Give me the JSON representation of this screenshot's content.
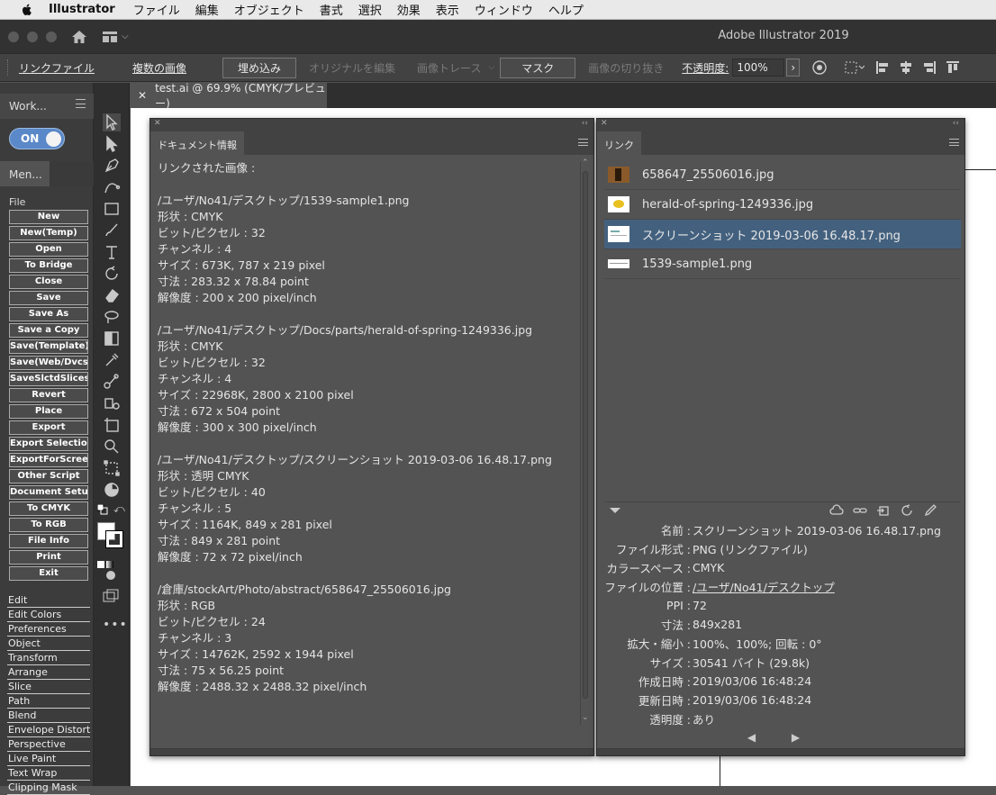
{
  "menubar": {
    "app": "Illustrator",
    "items": [
      "ファイル",
      "編集",
      "オブジェクト",
      "書式",
      "選択",
      "効果",
      "表示",
      "ウィンドウ",
      "ヘルプ"
    ]
  },
  "window": {
    "title": "Adobe Illustrator 2019"
  },
  "control_bar": {
    "link_file": "リンクファイル",
    "multiple_images": "複数の画像",
    "embed": "埋め込み",
    "edit_original": "オリジナルを編集",
    "image_trace": "画像トレース",
    "mask": "マスク",
    "crop_image": "画像の切り抜き",
    "opacity_label": "不透明度:",
    "opacity_value": "100%"
  },
  "document_tab": {
    "label": "test.ai @ 69.9% (CMYK/プレビュー)"
  },
  "workspace": {
    "label": "Work...",
    "toggle": "ON"
  },
  "menu_panel": {
    "tab": "Men...",
    "file_header": "File",
    "file_buttons": [
      "New",
      "New(Temp)",
      "Open",
      "To Bridge",
      "Close",
      "Save",
      "Save As",
      "Save a Copy",
      "Save(Template)",
      "Save(Web/Dvcs)",
      "SaveSlctdSlices",
      "Revert",
      "Place",
      "Export",
      "Export Selection",
      "ExportForScreens",
      "Other Script",
      "Document Setup",
      "To CMYK",
      "To RGB",
      "File Info",
      "Print",
      "Exit"
    ],
    "sections": [
      "Edit",
      "Edit Colors",
      "Preferences",
      "Object",
      "Transform",
      "Arrange",
      "Slice",
      "Path",
      "Blend",
      "Envelope Distort",
      "Perspective",
      "Live Paint",
      "Text Wrap",
      "Clipping Mask"
    ]
  },
  "tools": [
    "selection-tool",
    "direct-selection-tool",
    "pen-tool",
    "curvature-tool",
    "rectangle-tool",
    "paintbrush-tool",
    "type-tool",
    "rotate-tool",
    "eraser-tool",
    "lasso-tool",
    "gradient-tool",
    "eyedropper-tool",
    "blend-tool",
    "symbol-sprayer-tool",
    "artboard-tool",
    "zoom-tool",
    "free-transform-tool",
    "pie-graph-tool"
  ],
  "doc_info": {
    "tab": "ドキュメント情報",
    "text": "リンクされた画像 :\n\n/ユーザ/No41/デスクトップ/1539-sample1.png\n形状 : CMYK\nビット/ピクセル : 32\nチャンネル : 4\nサイズ : 673K, 787 x 219 pixel\n寸法 : 283.32 x 78.84 point\n解像度 : 200 x 200 pixel/inch\n\n/ユーザ/No41/デスクトップ/Docs/parts/herald-of-spring-1249336.jpg\n形状 : CMYK\nビット/ピクセル : 32\nチャンネル : 4\nサイズ : 22968K, 2800 x 2100 pixel\n寸法 : 672 x 504 point\n解像度 : 300 x 300 pixel/inch\n\n/ユーザ/No41/デスクトップ/スクリーンショット 2019-03-06 16.48.17.png\n形状 : 透明 CMYK\nビット/ピクセル : 40\nチャンネル : 5\nサイズ : 1164K, 849 x 281 pixel\n寸法 : 849 x 281 point\n解像度 : 72 x 72 pixel/inch\n\n/倉庫/stockArt/Photo/abstract/658647_25506016.jpg\n形状 : RGB\nビット/ピクセル : 24\nチャンネル : 3\nサイズ : 14762K, 2592 x 1944 pixel\n寸法 : 75 x 56.25 point\n解像度 : 2488.32 x 2488.32 pixel/inch"
  },
  "links": {
    "tab": "リンク",
    "items": [
      {
        "name": "658647_25506016.jpg",
        "selected": false
      },
      {
        "name": "herald-of-spring-1249336.jpg",
        "selected": false
      },
      {
        "name": "スクリーンショット 2019-03-06 16.48.17.png",
        "selected": true
      },
      {
        "name": "1539-sample1.png",
        "selected": false
      }
    ],
    "details": [
      {
        "key": "名前 :",
        "value": "スクリーンショット 2019-03-06 16.48.17.png"
      },
      {
        "key": "ファイル形式 :",
        "value": "PNG (リンクファイル)"
      },
      {
        "key": "カラースペース :",
        "value": "CMYK"
      },
      {
        "key": "ファイルの位置 :",
        "value": "/ユーザ/No41/デスクトップ"
      },
      {
        "key": "PPI :",
        "value": "72"
      },
      {
        "key": "寸法 :",
        "value": "849x281"
      },
      {
        "key": "拡大・縮小 :",
        "value": "100%、100%; 回転 : 0°"
      },
      {
        "key": "サイズ :",
        "value": "30541 バイト (29.8k)"
      },
      {
        "key": "作成日時 :",
        "value": "2019/03/06 16:48:24"
      },
      {
        "key": "更新日時 :",
        "value": "2019/03/06 16:48:24"
      },
      {
        "key": "透明度 :",
        "value": "あり"
      }
    ],
    "pager": "◀ ▶"
  },
  "colors": {
    "selected_row": "#43617f",
    "toggle_on": "#5a88c8"
  }
}
